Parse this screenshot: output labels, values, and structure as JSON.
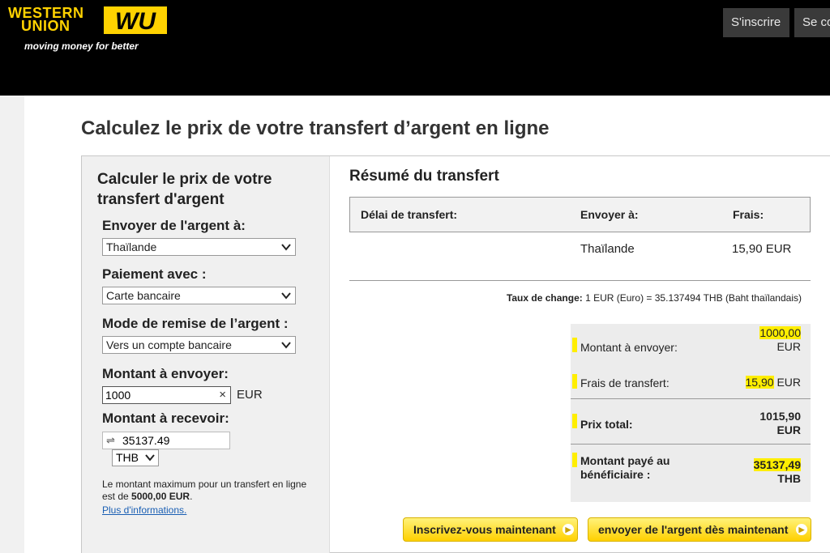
{
  "header": {
    "logo_line1": "WESTERN",
    "logo_line2": "UNION",
    "logo_mark": "WU",
    "tagline": "moving money for better",
    "signup_label": "S'inscrire",
    "login_label": "Se co"
  },
  "page": {
    "title": "Calculez le prix de votre transfert d’argent en ligne"
  },
  "calculator": {
    "title": "Calculer le prix de votre transfert d'argent",
    "send_to_label": "Envoyer de l'argent à:",
    "send_to_value": "Thaïlande",
    "payment_label": "Paiement avec :",
    "payment_value": "Carte bancaire",
    "delivery_label": "Mode de remise de l’argent :",
    "delivery_value": "Vers un compte bancaire",
    "amount_send_label": "Montant à envoyer:",
    "amount_send_value": "1000",
    "amount_send_currency": "EUR",
    "amount_receive_label": "Montant à recevoir:",
    "amount_receive_value": "35137.49",
    "receive_currency": "THB",
    "note_text": "Le montant maximum pour un transfert en ligne est de ",
    "note_max": "5000,00 EUR",
    "note_end": ".",
    "more_info": "Plus d'informations."
  },
  "summary": {
    "title": "Résumé du transfert",
    "col_delay": "Délai de transfert:",
    "col_send_to": "Envoyer à:",
    "col_fees": "Frais:",
    "row_send_to": "Thaïlande",
    "row_fees": "15,90 EUR",
    "rate_label": "Taux de change:",
    "rate_value": " 1 EUR (Euro) = 35.137494 THB (Baht thaïlandais)",
    "amount_label": "Montant à envoyer:",
    "amount_value": "1000,00",
    "amount_currency": "EUR",
    "fees_label": "Frais de transfert:",
    "fees_value": "15,90",
    "fees_currency": "EUR",
    "total_label": "Prix total:",
    "total_value": "1015,90",
    "total_currency": "EUR",
    "paid_label_1": "Montant payé au",
    "paid_label_2": "bénéficiaire :",
    "paid_value": "35137,49",
    "paid_currency": "THB",
    "cta_register": "Inscrivez-vous maintenant",
    "cta_send": "envoyer de l'argent dès maintenant"
  },
  "colors": {
    "brand_yellow": "#ffd200",
    "highlight": "#ffee00",
    "header_bg": "#000000"
  }
}
